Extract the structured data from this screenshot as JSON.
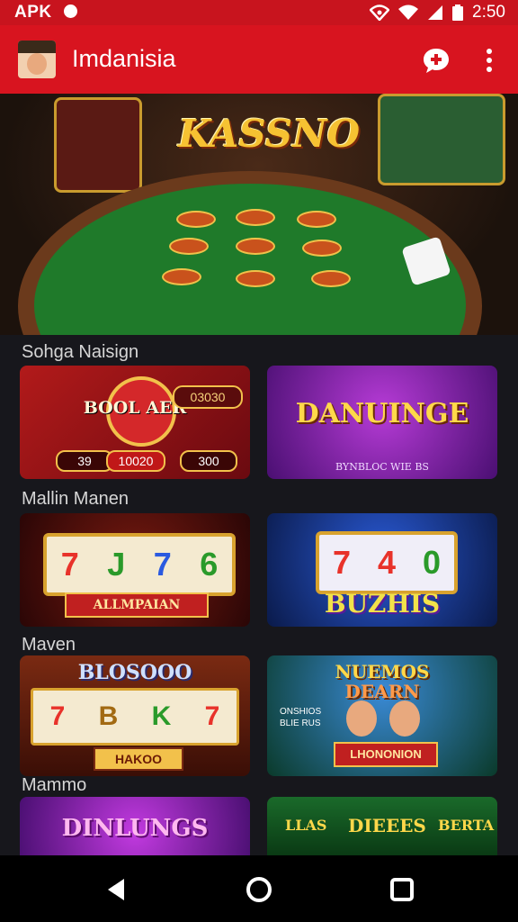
{
  "status_bar": {
    "left_text": "APK",
    "time": "2:50"
  },
  "app_bar": {
    "title": "Imdanisia"
  },
  "hero": {
    "title": "KASSNO"
  },
  "sections": [
    {
      "label": "Sohga Naisign"
    },
    {
      "label": "Mallin Manen"
    },
    {
      "label": "Maven"
    },
    {
      "label": "Mammo"
    }
  ],
  "tiles": {
    "r1_left": {
      "title": "BOOL AER",
      "badge_top": "03030",
      "badge_1": "39",
      "badge_2": "10020",
      "badge_3": "300"
    },
    "r1_right": {
      "title": "DANUINGE",
      "subtitle": "BYNBLOC WIE BS"
    },
    "r2_left": {
      "reels": [
        "7",
        "J",
        "7",
        "6"
      ],
      "banner": "ALLMPAIAN"
    },
    "r2_right": {
      "reels": [
        "7",
        "4",
        "0"
      ],
      "banner": "BUZHIS"
    },
    "r3_left": {
      "title": "BLOSOOO",
      "reels": [
        "7",
        "B",
        "K",
        "7"
      ],
      "banner": "HAKOO"
    },
    "r3_right": {
      "title_1": "NUEMOS",
      "title_2": "DEARN",
      "side": "ONSHIOS BLIE RUS",
      "banner": "LHONONION"
    },
    "r4_left": {
      "title": "DINLUNGS"
    },
    "r4_right": {
      "title_1": "LLAS",
      "title_2": "DIEEES",
      "title_3": "BERTA"
    }
  },
  "colors": {
    "brand_red": "#d8141f",
    "status_red": "#c8141e",
    "background": "#17171c",
    "nav_bg": "#000000",
    "felt_green": "#1f7a2a",
    "gold": "#f6c232"
  },
  "icons": [
    "signal-icon",
    "wifi-icon",
    "battery-icon",
    "chat-icon",
    "more-vert-icon",
    "back-icon",
    "home-icon",
    "recents-icon"
  ]
}
